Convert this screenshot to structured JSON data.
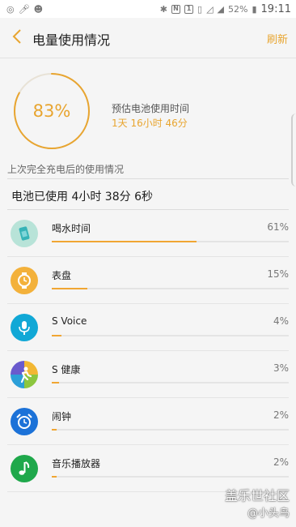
{
  "status_bar": {
    "battery_percent": "52%",
    "time": "19:11"
  },
  "header": {
    "title": "电量使用情况",
    "refresh_label": "刷新"
  },
  "summary": {
    "battery_level": "83%",
    "battery_level_value": 83,
    "estimate_label": "预估电池使用时间",
    "estimate_value": "1天 16小时 46分"
  },
  "section_label": "上次完全充电后的使用情况",
  "usage_total": "电池已使用 4小时 38分 6秒",
  "colors": {
    "accent": "#e8a530",
    "bar": "#f0a633",
    "track": "#e4e4e4"
  },
  "apps": [
    {
      "name": "喝水时间",
      "percent_label": "61%",
      "percent": 61,
      "icon": "water-app-icon"
    },
    {
      "name": "表盘",
      "percent_label": "15%",
      "percent": 15,
      "icon": "watch-face-icon"
    },
    {
      "name": "S Voice",
      "percent_label": "4%",
      "percent": 4,
      "icon": "microphone-icon"
    },
    {
      "name": "S 健康",
      "percent_label": "3%",
      "percent": 3,
      "icon": "s-health-icon"
    },
    {
      "name": "闹钟",
      "percent_label": "2%",
      "percent": 2,
      "icon": "alarm-clock-icon"
    },
    {
      "name": "音乐播放器",
      "percent_label": "2%",
      "percent": 2,
      "icon": "music-note-icon"
    }
  ],
  "watermark": {
    "line1": "盖乐世社区",
    "line2": "@小头鸟"
  }
}
